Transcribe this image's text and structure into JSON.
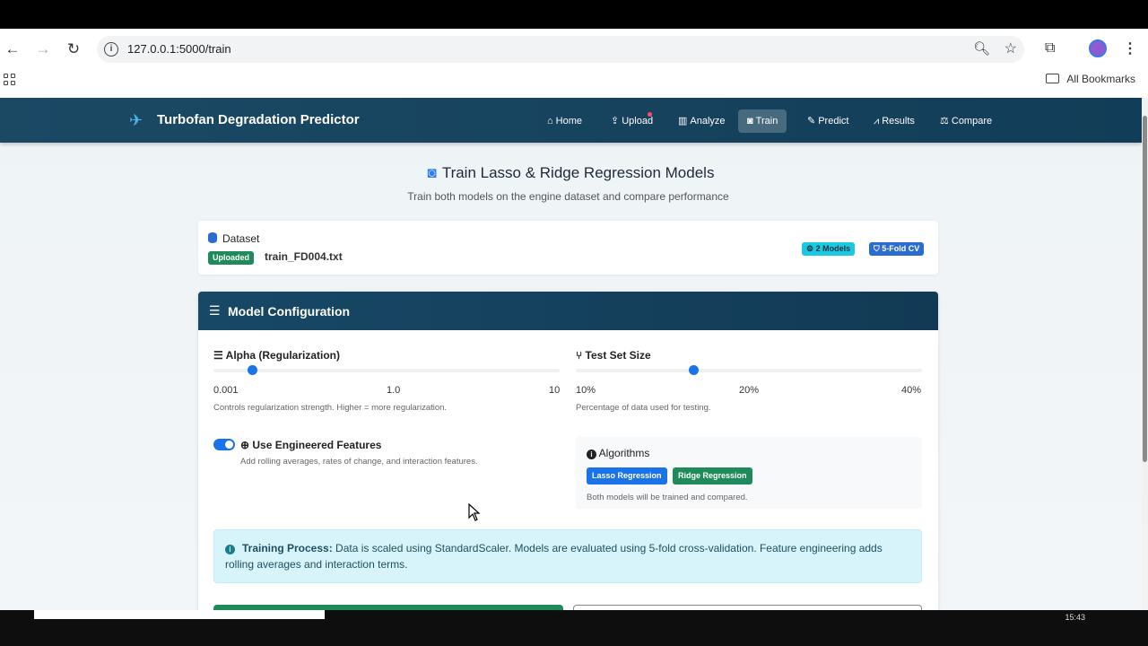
{
  "browser": {
    "url": "127.0.0.1:5000/train",
    "bookmarks_label": "All Bookmarks"
  },
  "app": {
    "brand": "Turbofan Degradation Predictor",
    "nav": [
      {
        "label": "Home",
        "icon": "home-icon"
      },
      {
        "label": "Upload",
        "icon": "upload-icon"
      },
      {
        "label": "Analyze",
        "icon": "chart-icon"
      },
      {
        "label": "Train",
        "icon": "robot-icon",
        "active": true
      },
      {
        "label": "Predict",
        "icon": "pencil-icon"
      },
      {
        "label": "Results",
        "icon": "line-chart-icon"
      },
      {
        "label": "Compare",
        "icon": "scale-icon"
      }
    ]
  },
  "header": {
    "title": "Train Lasso & Ridge Regression Models",
    "subtitle": "Train both models on the engine dataset and compare performance"
  },
  "dataset": {
    "label": "Dataset",
    "status_badge": "Uploaded",
    "file_name": "train_FD004.txt",
    "badge_models": "2 Models",
    "badge_cv": "5-Fold CV"
  },
  "config": {
    "title": "Model Configuration",
    "alpha": {
      "label": "Alpha (Regularization)",
      "ticks": [
        "0.001",
        "1.0",
        "10"
      ],
      "help": "Controls regularization strength. Higher = more regularization."
    },
    "test_size": {
      "label": "Test Set Size",
      "ticks": [
        "10%",
        "20%",
        "40%"
      ],
      "help": "Percentage of data used for testing."
    },
    "features": {
      "label": "Use Engineered Features",
      "help": "Add rolling averages, rates of change, and interaction features.",
      "enabled": true
    },
    "algorithms": {
      "label": "Algorithms",
      "items": [
        "Lasso Regression",
        "Ridge Regression"
      ],
      "help": "Both models will be trained and compared."
    },
    "info": {
      "title": "Training Process:",
      "text": " Data is scaled using StandardScaler. Models are evaluated using 5-fold cross-validation. Feature engineering adds rolling averages and interaction terms."
    }
  },
  "taskbar": {
    "time": "15:43"
  },
  "colors": {
    "nav_bg": "#1b4964",
    "accent": "#1a73e8",
    "success": "#1f8a5a",
    "info_bg": "#d8f4fb",
    "badge_cyan": "#1cc7e0"
  }
}
